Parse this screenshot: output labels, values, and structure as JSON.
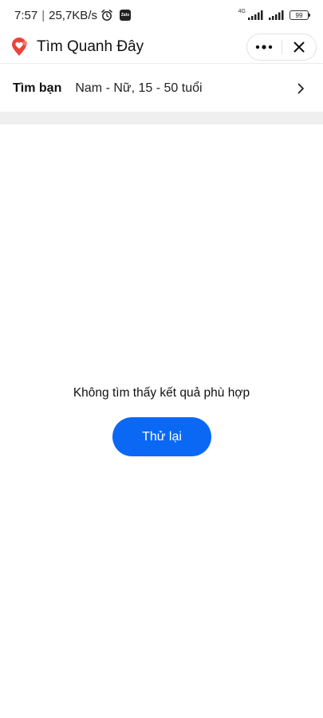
{
  "status_bar": {
    "time": "7:57",
    "separator": "|",
    "network_speed": "25,7KB/s",
    "zalo_label": "Zalo",
    "network_type": "4G",
    "battery": "99",
    "icons": [
      "alarm-icon",
      "zalo-icon",
      "signal-icon",
      "signal-icon",
      "battery-icon"
    ]
  },
  "header": {
    "title": "Tìm Quanh Đây",
    "logo_icon": "location-pin-heart-icon",
    "more_icon": "more-dots-icon",
    "close_icon": "close-icon",
    "logo_color": "#e8453c"
  },
  "filter": {
    "label": "Tìm bạn",
    "value": "Nam - Nữ, 15 - 50 tuổi",
    "icon": "chevron-right-icon"
  },
  "empty_state": {
    "message": "Không tìm thấy kết quả phù hợp",
    "retry_label": "Thử lại"
  },
  "colors": {
    "accent": "#0a68f5",
    "band": "#efefef"
  }
}
